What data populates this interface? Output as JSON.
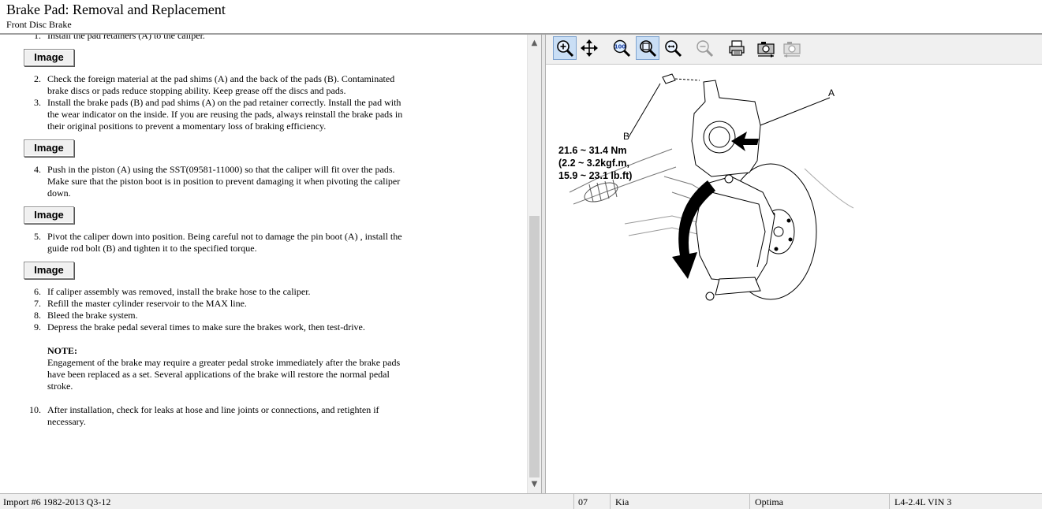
{
  "header": {
    "title": "Brake Pad:  Removal and Replacement",
    "subtitle": "Front Disc Brake"
  },
  "content": {
    "cut_off_line": "Install the pad retainers (A) to the caliper.",
    "image_button_label": "Image",
    "steps": [
      {
        "num": "2.",
        "text": "Check the foreign material at the pad shims (A) and the back of the pads (B). Contaminated brake discs or pads reduce stopping ability. Keep grease off the discs and pads."
      },
      {
        "num": "3.",
        "text": "Install the brake pads (B) and pad shims (A) on the pad retainer correctly. Install the pad with the wear indicator on the inside. If you are reusing the pads, always reinstall the brake pads in their original positions to prevent a momentary loss of braking efficiency."
      },
      {
        "num": "4.",
        "text": "Push in the piston (A) using the SST(09581-11000) so that the caliper will fit over the pads. Make sure that the piston boot is in position to prevent damaging it when pivoting the caliper down."
      },
      {
        "num": "5.",
        "text": "Pivot the caliper down into position. Being careful not to damage the pin boot (A) , install the guide rod bolt (B) and tighten it to the specified torque."
      },
      {
        "num": "6.",
        "text": "If caliper assembly was removed, install the brake hose to the caliper."
      },
      {
        "num": "7.",
        "text": "Refill the master cylinder reservoir to the MAX line."
      },
      {
        "num": "8.",
        "text": "Bleed the brake system."
      },
      {
        "num": "9.",
        "text": "Depress the brake pedal several times to make sure the brakes work, then test-drive."
      },
      {
        "num": "10.",
        "text": "After installation, check for leaks at hose and line joints or connections, and retighten if necessary."
      }
    ],
    "note_title": "NOTE:",
    "note_text": "Engagement of the brake may require a greater pedal stroke immediately after the brake pads have been replaced as a set. Several applications of the brake will restore the normal pedal stroke."
  },
  "toolbar": {
    "buttons": [
      "zoom-in",
      "pan",
      "zoom-100",
      "zoom-fit",
      "zoom-out",
      "zoom-out-disabled",
      "print",
      "camera",
      "camera-disabled"
    ]
  },
  "diagram": {
    "label_b": "B",
    "label_a": "A",
    "torque_line1": "21.6 ~ 31.4 Nm",
    "torque_line2": "(2.2 ~ 3.2kgf.m,",
    "torque_line3": "15.9 ~ 23.1 lb.ft)"
  },
  "status": {
    "import": "Import #6 1982-2013 Q3-12",
    "year": "07",
    "make": "Kia",
    "model": "Optima",
    "engine": "L4-2.4L VIN 3"
  },
  "colors": {
    "toolbar_bg": "#f0f0f0",
    "active_button": "#c9def5",
    "divider": "#e8e8e8"
  }
}
